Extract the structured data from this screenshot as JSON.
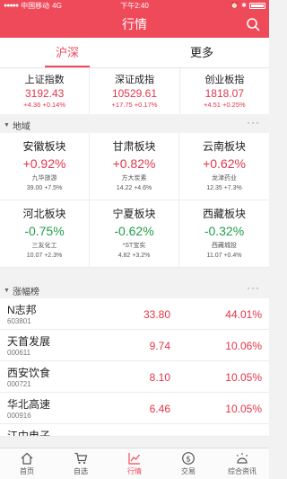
{
  "status_bar": {
    "carrier": "中国移动",
    "network": "4G",
    "time": "下午2:40"
  },
  "header": {
    "title": "行情"
  },
  "tabs": [
    {
      "label": "沪深",
      "active": true
    },
    {
      "label": "更多",
      "active": false
    }
  ],
  "indices": [
    {
      "name": "上证指数",
      "value": "3192.43",
      "change": "+4.36  +0.14%"
    },
    {
      "name": "深证成指",
      "value": "10529.61",
      "change": "+17.75  +0.17%"
    },
    {
      "name": "创业板指",
      "value": "1818.07",
      "change": "+4.51  +0.25%"
    }
  ],
  "sector_section": {
    "title": "地域",
    "more": "···"
  },
  "sectors": [
    {
      "name": "安徽板块",
      "change": "+0.92%",
      "direction": "up",
      "stock": "九华旅游",
      "price": "39.00",
      "stock_change": "+7.5%"
    },
    {
      "name": "甘肃板块",
      "change": "+0.82%",
      "direction": "up",
      "stock": "方大炭素",
      "price": "14.22",
      "stock_change": "+4.6%"
    },
    {
      "name": "云南板块",
      "change": "+0.62%",
      "direction": "up",
      "stock": "龙津药业",
      "price": "12.35",
      "stock_change": "+7.3%"
    },
    {
      "name": "河北板块",
      "change": "-0.75%",
      "direction": "down",
      "stock": "三友化工",
      "price": "10.07",
      "stock_change": "+2.3%"
    },
    {
      "name": "宁夏板块",
      "change": "-0.62%",
      "direction": "down",
      "stock": "*ST宝实",
      "price": "4.82",
      "stock_change": "+3.2%"
    },
    {
      "name": "西藏板块",
      "change": "-0.32%",
      "direction": "down",
      "stock": "西藏城投",
      "price": "11.07",
      "stock_change": "+0.4%"
    }
  ],
  "gainers_section": {
    "title": "涨幅榜",
    "more": "···"
  },
  "gainers": [
    {
      "name": "N志邦",
      "code": "603801",
      "price": "33.80",
      "pct": "44.01%"
    },
    {
      "name": "天首发展",
      "code": "000611",
      "price": "9.74",
      "pct": "10.06%"
    },
    {
      "name": "西安饮食",
      "code": "000721",
      "price": "8.10",
      "pct": "10.05%"
    },
    {
      "name": "华北高速",
      "code": "000916",
      "price": "6.46",
      "pct": "10.05%"
    },
    {
      "name": "江中电子",
      "code": "",
      "price": "",
      "pct": ""
    }
  ],
  "bottom_nav": [
    {
      "label": "首页",
      "icon": "home-icon",
      "active": false
    },
    {
      "label": "自选",
      "icon": "cart-icon",
      "active": false
    },
    {
      "label": "行情",
      "icon": "trend-icon",
      "active": true
    },
    {
      "label": "交易",
      "icon": "dollar-icon",
      "active": false
    },
    {
      "label": "综合资讯",
      "icon": "news-icon",
      "active": false
    }
  ],
  "colors": {
    "brand": "#ef4a5a",
    "up": "#e3364a",
    "down": "#1fa04a"
  }
}
